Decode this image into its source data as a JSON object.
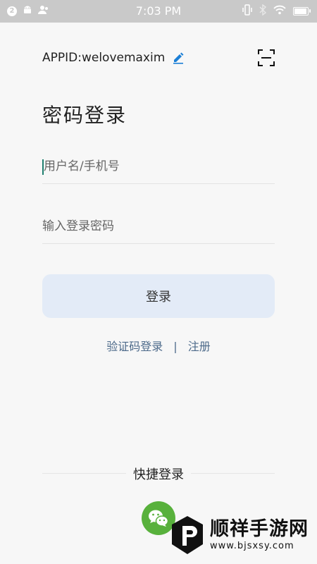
{
  "status_bar": {
    "notification_count": "2",
    "time": "7:03 PM",
    "battery_level": 0.85
  },
  "header": {
    "appid": "APPID:welovemaxim"
  },
  "page": {
    "title": "密码登录"
  },
  "form": {
    "username_placeholder": "用户名/手机号",
    "password_placeholder": "输入登录密码",
    "login_label": "登录"
  },
  "links": {
    "sms_login": "验证码登录",
    "separator": "|",
    "register": "注册"
  },
  "quick_login": {
    "title": "快捷登录"
  },
  "watermark": {
    "title": "顺祥手游网",
    "url": "www.bjsxsy.com"
  },
  "colors": {
    "accent": "#1b7fd6",
    "wechat": "#58b13c",
    "login_button_bg": "#e3ebf7",
    "link": "#4d6a8a"
  }
}
